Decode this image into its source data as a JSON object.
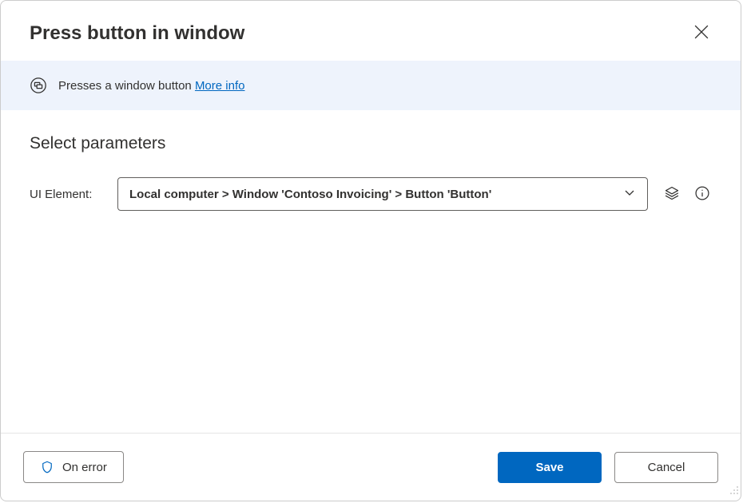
{
  "header": {
    "title": "Press button in window"
  },
  "info": {
    "description": "Presses a window button ",
    "link_label": "More info"
  },
  "parameters": {
    "section_title": "Select parameters",
    "ui_element_label": "UI Element:",
    "ui_element_value": "Local computer > Window 'Contoso Invoicing' > Button 'Button'"
  },
  "footer": {
    "on_error_label": "On error",
    "save_label": "Save",
    "cancel_label": "Cancel"
  }
}
